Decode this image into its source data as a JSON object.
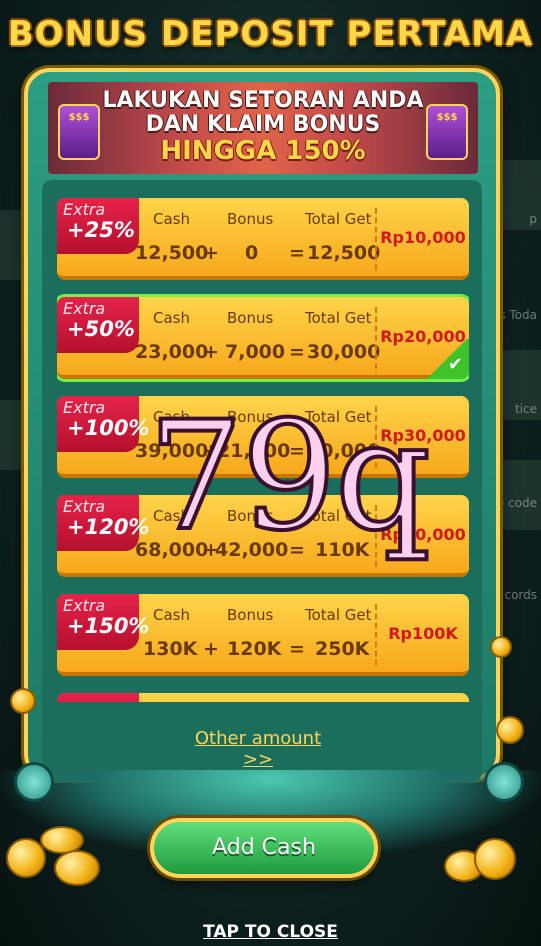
{
  "title": "BONUS DEPOSIT PERTAMA",
  "banner": {
    "line1": "LAKUKAN SETORAN ANDA",
    "line2": "DAN KLAIM BONUS",
    "line3": "HINGGA 150%"
  },
  "background_labels": [
    "p",
    "s Toda",
    "tice",
    "no code",
    "cords"
  ],
  "columns": {
    "cash": "Cash",
    "bonus": "Bonus",
    "total": "Total Get"
  },
  "rows": [
    {
      "extra": "Extra",
      "percent": "+25%",
      "cash": "12,500",
      "bonus": "0",
      "total": "12,500",
      "price": "Rp10,000",
      "selected": false
    },
    {
      "extra": "Extra",
      "percent": "+50%",
      "cash": "23,000",
      "bonus": "7,000",
      "total": "30,000",
      "price": "Rp20,000",
      "selected": true
    },
    {
      "extra": "Extra",
      "percent": "+100%",
      "cash": "39,000",
      "bonus": "21,000",
      "total": "60,000",
      "price": "Rp30,000",
      "selected": false
    },
    {
      "extra": "Extra",
      "percent": "+120%",
      "cash": "68,000",
      "bonus": "42,000",
      "total": "110K",
      "price": "Rp50,000",
      "selected": false
    },
    {
      "extra": "Extra",
      "percent": "+150%",
      "cash": "130K",
      "bonus": "120K",
      "total": "250K",
      "price": "Rp100K",
      "selected": false
    }
  ],
  "operators": {
    "plus": "+",
    "equals": "="
  },
  "check_glyph": "✔",
  "watermark": "79q",
  "other_amount": "Other amount >>",
  "add_cash": "Add Cash",
  "tap_to_close": "TAP TO CLOSE",
  "colors": {
    "title": "#ffd84a",
    "panel": "#2d9e82",
    "row": "#ffd44a",
    "ribbon": "#e6234a",
    "price": "#d21818",
    "selected_outline": "#6ff04a",
    "button": "#1f9a3e"
  }
}
